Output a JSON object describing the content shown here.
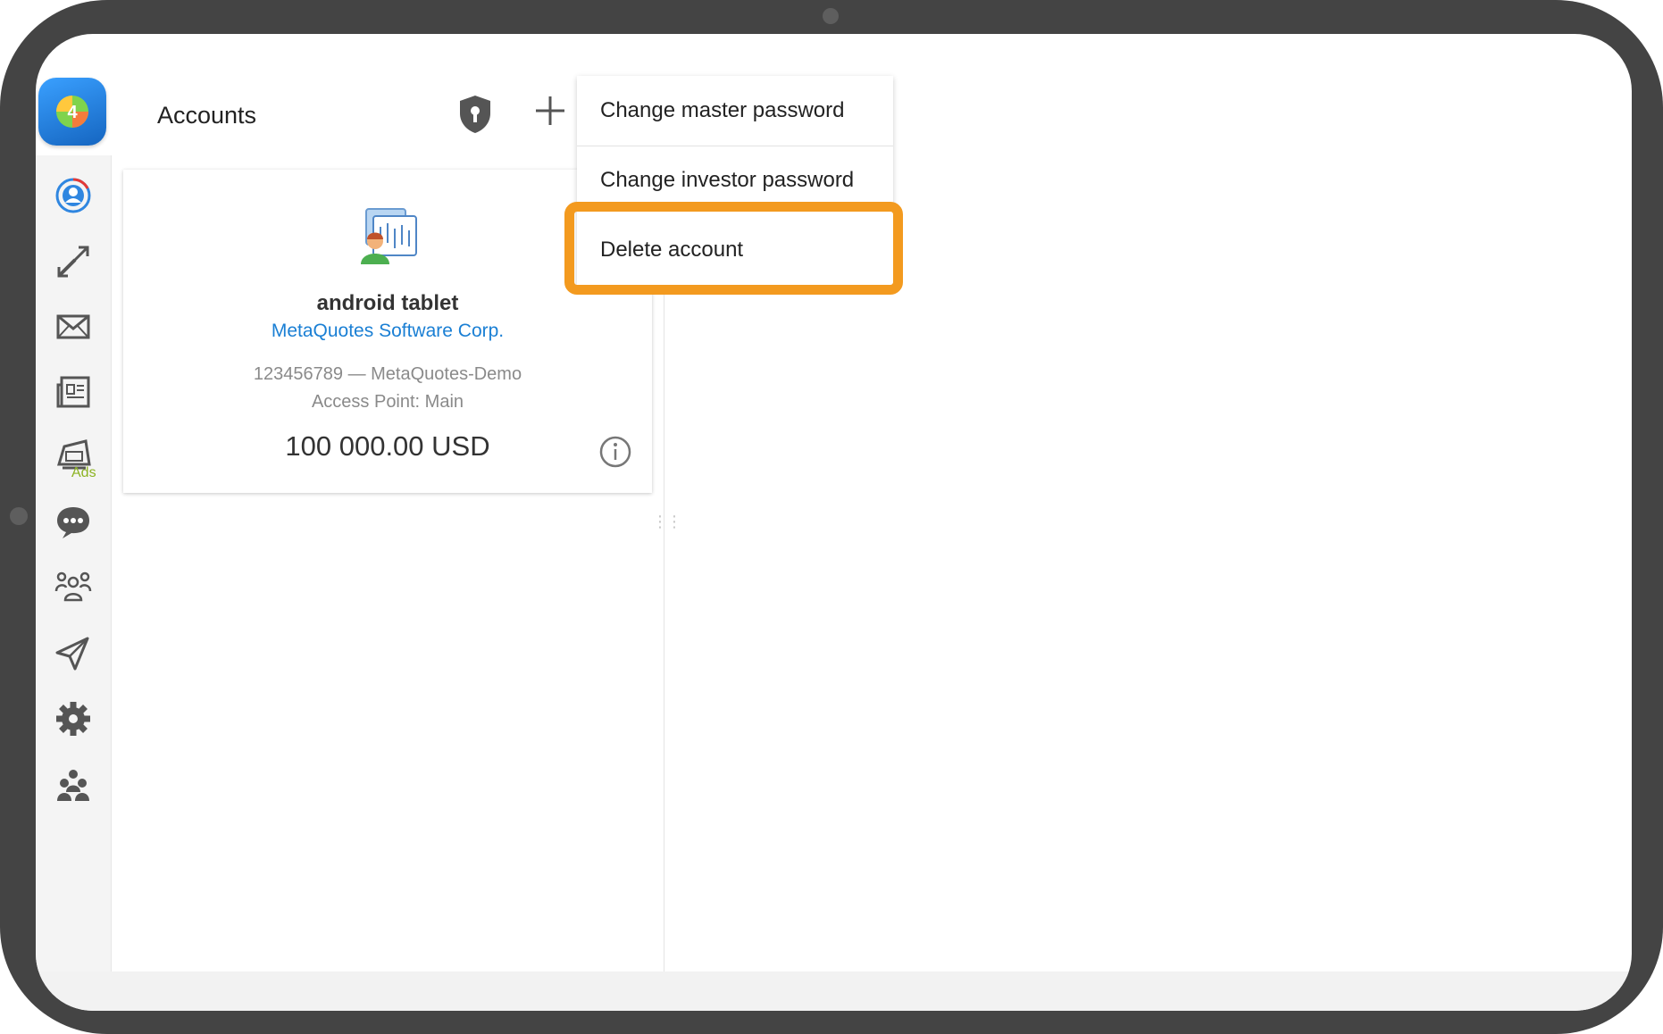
{
  "header": {
    "title": "Accounts",
    "shield_icon": "shield-lock-icon",
    "add_icon": "plus-icon"
  },
  "sidebar": {
    "logo_icon": "metatrader-logo-icon",
    "items": [
      {
        "name": "account-icon"
      },
      {
        "name": "trade-icon"
      },
      {
        "name": "mail-icon"
      },
      {
        "name": "news-icon"
      },
      {
        "name": "ads-icon",
        "label": "Ads"
      },
      {
        "name": "chat-icon"
      },
      {
        "name": "community-icon"
      },
      {
        "name": "telegram-icon"
      },
      {
        "name": "settings-icon"
      },
      {
        "name": "traders-icon"
      }
    ]
  },
  "account_card": {
    "name": "android tablet",
    "company": "MetaQuotes Software Corp.",
    "number_server": "123456789 — MetaQuotes-Demo",
    "access_point": "Access Point: Main",
    "balance": "100 000.00 USD",
    "status_color": "#2fb43a"
  },
  "context_menu": {
    "items": [
      {
        "label": "Change master password"
      },
      {
        "label": "Change investor password"
      },
      {
        "label": "Delete account"
      }
    ],
    "highlighted": "Delete account",
    "highlight_color": "#f39a1f"
  }
}
